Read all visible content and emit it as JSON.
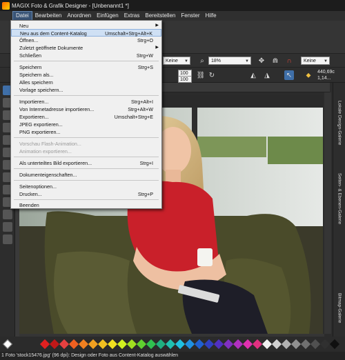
{
  "window": {
    "title": "MAGIX Foto & Grafik Designer - [Unbenannt1 *]"
  },
  "menubar": {
    "items": [
      "Datei",
      "Bearbeiten",
      "Anordnen",
      "Einfügen",
      "Extras",
      "Bereitstellen",
      "Fenster",
      "Hilfe"
    ]
  },
  "toolbar": {
    "font_select": "Keine",
    "zoom_value": "18%",
    "snap_select": "Keine",
    "width_value": "100",
    "height_value": "100",
    "readout_x": "440,69c",
    "readout_y": "1,14..."
  },
  "file_menu": {
    "items": [
      {
        "label": "Neu",
        "shortcut": "",
        "submenu": true
      },
      {
        "label": "Neu aus dem Content-Katalog",
        "shortcut": "Umschalt+Strg+Alt+K",
        "hover": true
      },
      {
        "label": "Öffnen...",
        "shortcut": "Strg+O"
      },
      {
        "label": "Zuletzt geöffnete Dokumente",
        "shortcut": "",
        "submenu": true
      },
      {
        "label": "Schließen",
        "shortcut": "Strg+W"
      },
      {
        "label": "Speichern",
        "shortcut": "Strg+S"
      },
      {
        "label": "Speichern als...",
        "shortcut": ""
      },
      {
        "label": "Alles speichern",
        "shortcut": ""
      },
      {
        "label": "Vorlage speichern...",
        "shortcut": ""
      },
      {
        "label": "Importieren...",
        "shortcut": "Strg+Alt+I"
      },
      {
        "label": "Von Internetadresse importieren...",
        "shortcut": "Strg+Alt+W"
      },
      {
        "label": "Exportieren...",
        "shortcut": "Umschalt+Strg+E"
      },
      {
        "label": "JPEG exportieren...",
        "shortcut": ""
      },
      {
        "label": "PNG exportieren...",
        "shortcut": ""
      },
      {
        "label": "Vorschau Flash-Animation...",
        "shortcut": "",
        "disabled": true
      },
      {
        "label": "Animation exportieren...",
        "shortcut": "",
        "disabled": true
      },
      {
        "label": "Als unterteiltes Bild exportieren...",
        "shortcut": "Strg+I"
      },
      {
        "label": "Dokumenteigenschaften...",
        "shortcut": ""
      },
      {
        "label": "Seitenoptionen...",
        "shortcut": ""
      },
      {
        "label": "Drucken...",
        "shortcut": "Strg+P"
      },
      {
        "label": "Beenden",
        "shortcut": ""
      }
    ]
  },
  "right_panel": {
    "tabs": [
      "Lokale Design-Galerie",
      "Seiten- & Ebenen-Galerie",
      "Bitmap-Galerie"
    ]
  },
  "status": {
    "text": "1 Foto 'stock15476.jpg' (96 dpi): Design oder Foto aus Content-Katalog auswählen"
  },
  "colors": {
    "accent": "#3f6fa8",
    "menu_hover": "#cfe0f4",
    "menu_bg": "#f0f0f0"
  }
}
